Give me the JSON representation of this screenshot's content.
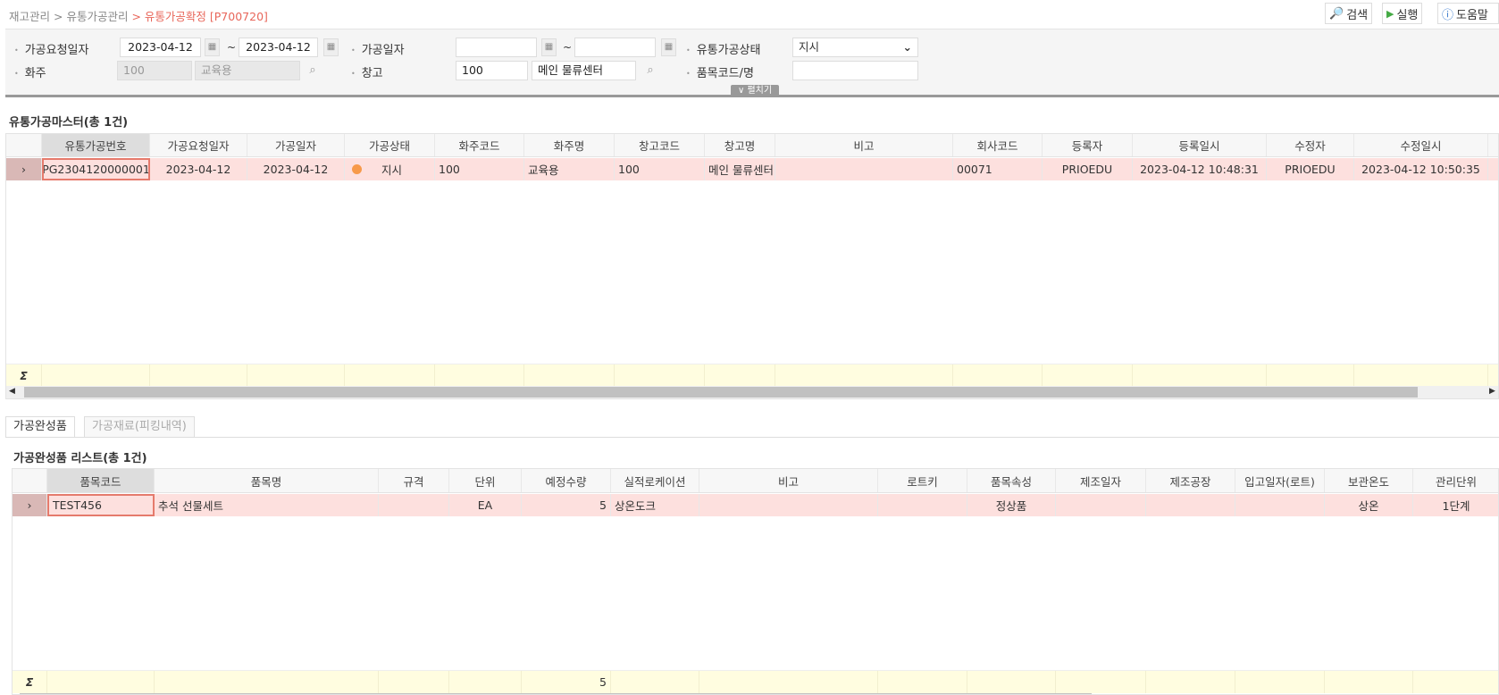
{
  "breadcrumb": {
    "items": [
      "재고관리",
      "유통가공관리"
    ],
    "separator": ">",
    "current": "> 유통가공확정 [P700720]"
  },
  "toolbar": {
    "search": "검색",
    "run": "실행",
    "help": "도움말"
  },
  "filters": {
    "req_date_label": "가공요청일자",
    "req_date_from": "2023-04-12",
    "req_date_to": "2023-04-12",
    "tilde": "~",
    "proc_date_label": "가공일자",
    "proc_date_from": "",
    "proc_date_to": "",
    "status_label": "유통가공상태",
    "status_value": "지시",
    "owner_label": "화주",
    "owner_code": "100",
    "owner_name": "교육용",
    "warehouse_label": "창고",
    "warehouse_code": "100",
    "warehouse_name": "메인 물류센터",
    "item_label": "품목코드/명",
    "item_value": "",
    "expand": "펼치기"
  },
  "master": {
    "title": "유통가공마스터(총 1건)",
    "columns": [
      "유통가공번호",
      "가공요청일자",
      "가공일자",
      "가공상태",
      "화주코드",
      "화주명",
      "창고코드",
      "창고명",
      "비고",
      "회사코드",
      "등록자",
      "등록일시",
      "수정자",
      "수정일시"
    ],
    "rows": [
      [
        "PG2304120000001",
        "2023-04-12",
        "2023-04-12",
        "지시",
        "100",
        "교육용",
        "100",
        "메인 물류센터",
        "",
        "00071",
        "PRIOEDU",
        "2023-04-12 10:48:31",
        "PRIOEDU",
        "2023-04-12 10:50:35"
      ]
    ],
    "status_color": "#f79a4a",
    "sum_symbol": "Σ"
  },
  "tabs": [
    {
      "label": "가공완성품",
      "active": true
    },
    {
      "label": "가공재료(피킹내역)",
      "active": false
    }
  ],
  "detail": {
    "title": "가공완성품 리스트(총 1건)",
    "columns": [
      "품목코드",
      "품목명",
      "규격",
      "단위",
      "예정수량",
      "실적로케이션",
      "비고",
      "로트키",
      "품목속성",
      "제조일자",
      "제조공장",
      "입고일자(로트)",
      "보관온도",
      "관리단위"
    ],
    "rows": [
      [
        "TEST456",
        "추석 선물세트",
        "",
        "EA",
        "5",
        "상온도크",
        "",
        "",
        "정상품",
        "",
        "",
        "",
        "상온",
        "1단계"
      ]
    ],
    "sum_qty": "5",
    "sum_symbol": "Σ"
  },
  "colors": {
    "accent": "#e8665a",
    "selected_row": "#fde0de",
    "sum_row": "#fffde0"
  }
}
